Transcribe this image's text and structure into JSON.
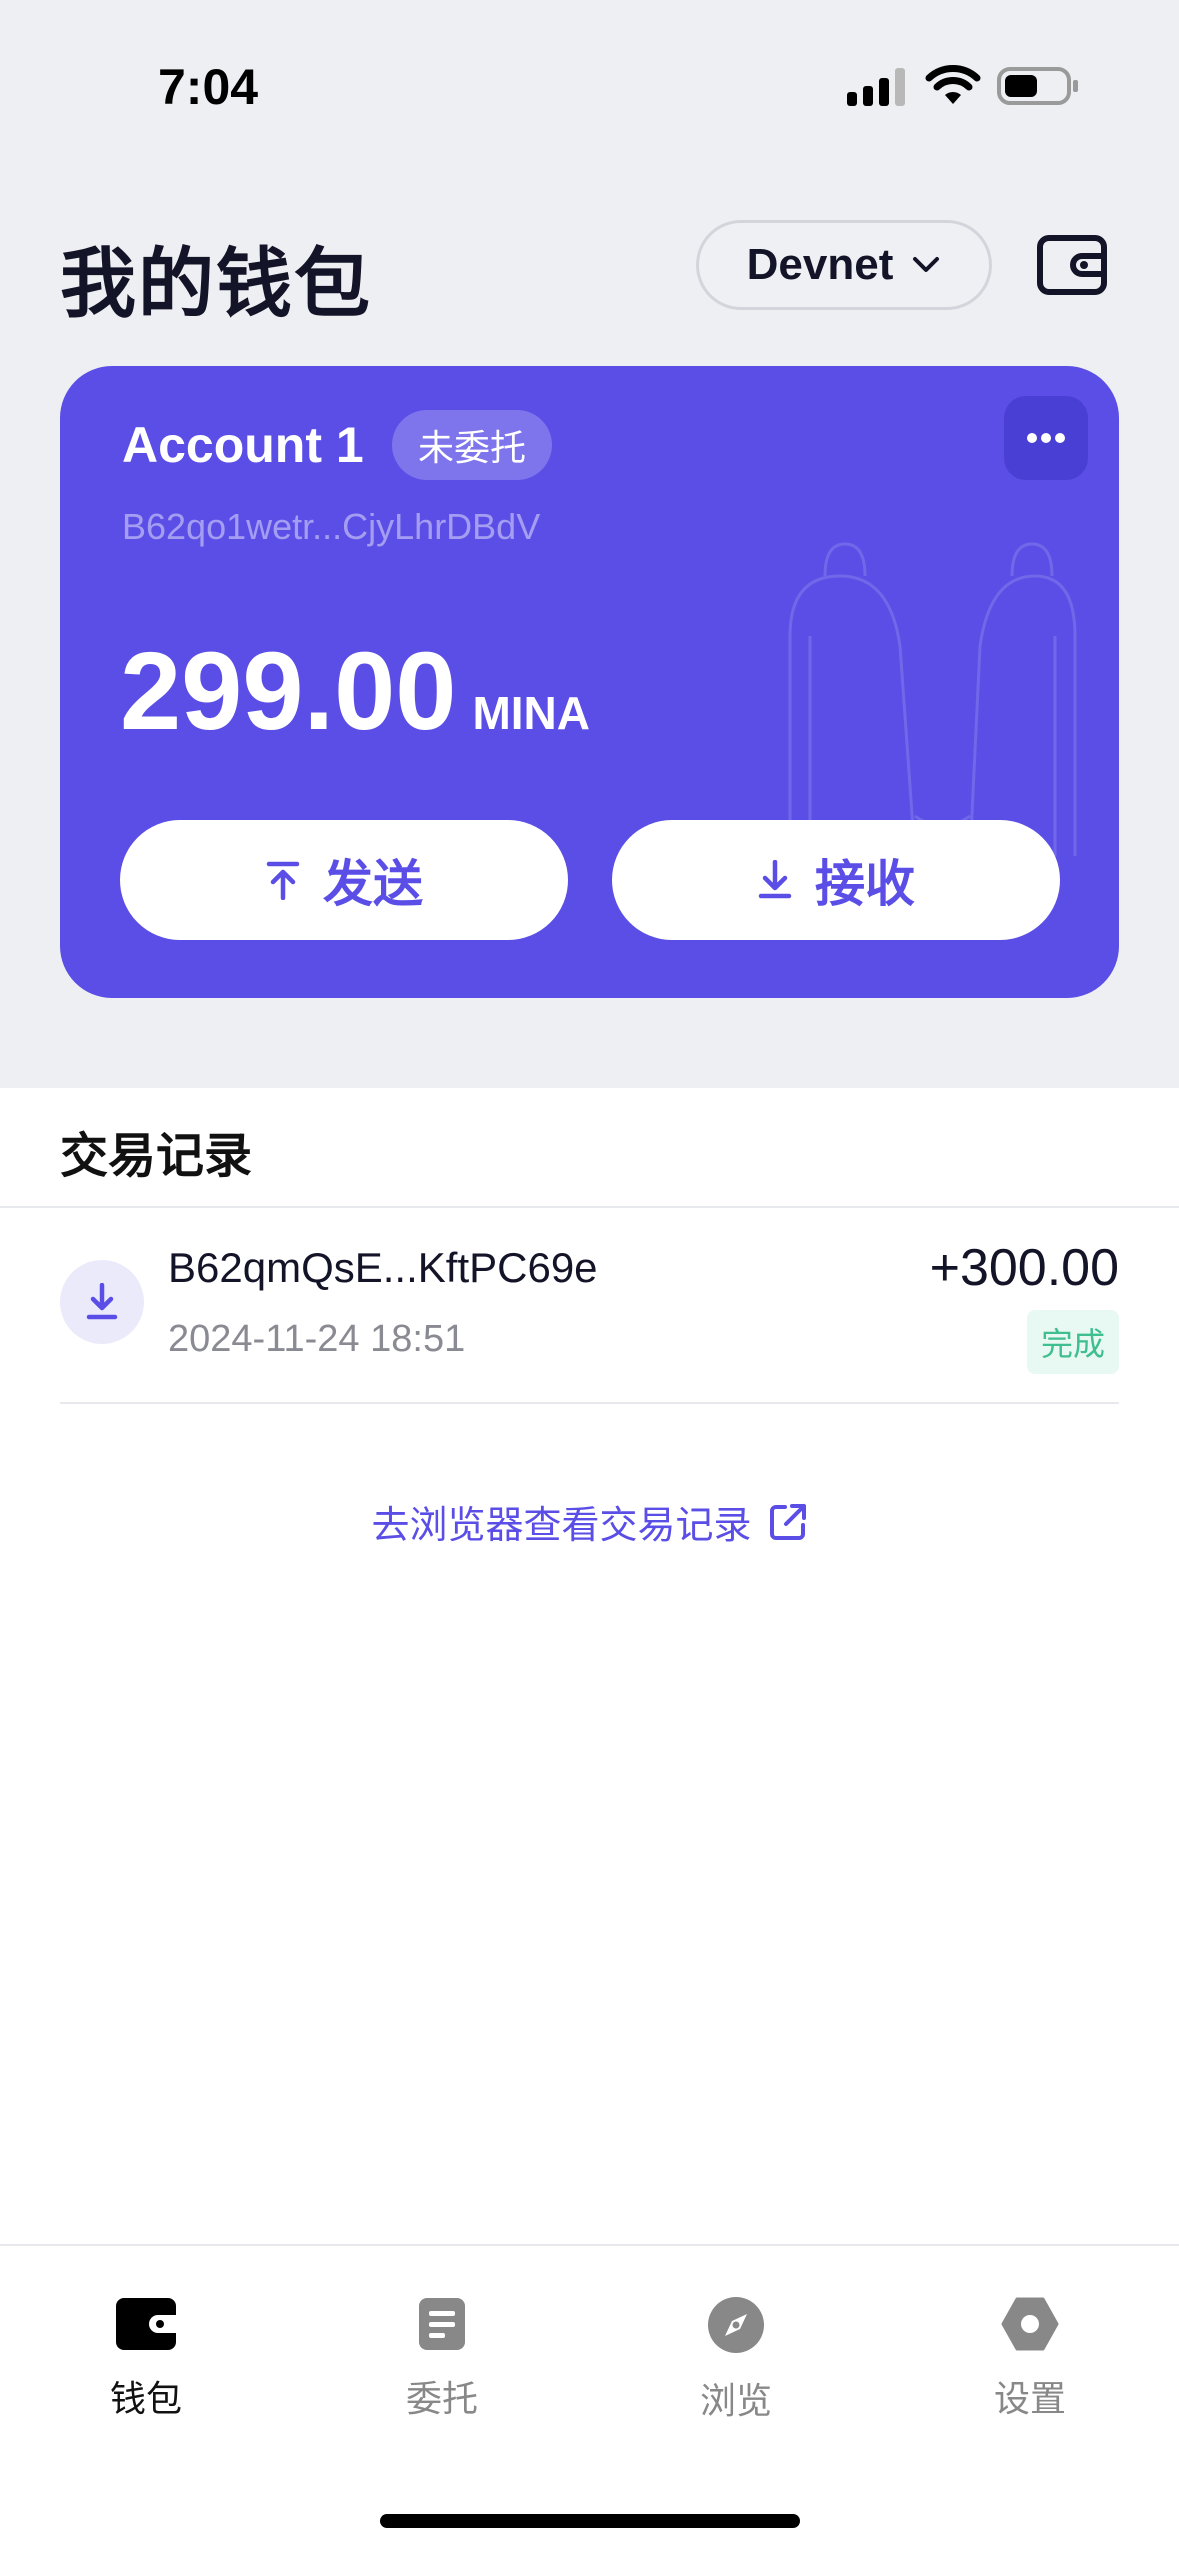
{
  "status_bar": {
    "time": "7:04"
  },
  "header": {
    "title": "我的钱包",
    "network": "Devnet"
  },
  "account_card": {
    "name": "Account 1",
    "delegation_badge": "未委托",
    "address": "B62qo1wetr...CjyLhrDBdV",
    "balance": "299.00",
    "unit": "MINA",
    "send_label": "发送",
    "receive_label": "接收",
    "accent_color": "#5a4ee6"
  },
  "transactions": {
    "title": "交易记录",
    "items": [
      {
        "address": "B62qmQsE...KftPC69e",
        "date": "2024-11-24 18:51",
        "amount": "+300.00",
        "status": "完成",
        "type_icon": "receive-icon"
      }
    ],
    "explorer_link": "去浏览器查看交易记录"
  },
  "tabbar": {
    "items": [
      {
        "label": "钱包",
        "icon": "wallet-icon",
        "active": true
      },
      {
        "label": "委托",
        "icon": "document-icon",
        "active": false
      },
      {
        "label": "浏览",
        "icon": "compass-icon",
        "active": false
      },
      {
        "label": "设置",
        "icon": "gear-icon",
        "active": false
      }
    ]
  }
}
